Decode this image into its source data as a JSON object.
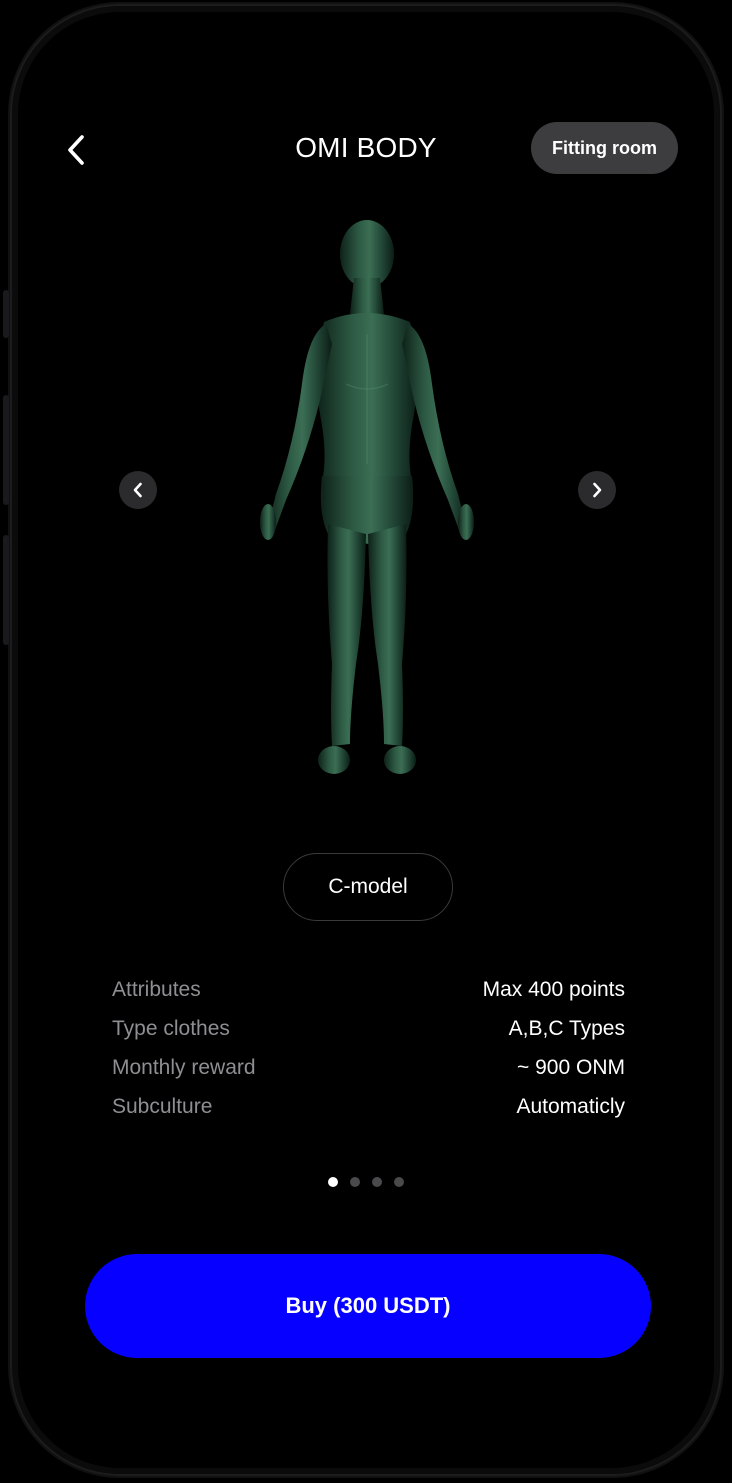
{
  "header": {
    "title": "OMI BODY",
    "fitting_room_label": "Fitting room"
  },
  "carousel": {
    "model_label": "C-model",
    "page_count": 4,
    "active_page": 1
  },
  "specs": [
    {
      "label": "Attributes",
      "value": "Max 400 points"
    },
    {
      "label": "Type clothes",
      "value": "A,B,C Types"
    },
    {
      "label": "Monthly reward",
      "value": "~ 900 ONM"
    },
    {
      "label": "Subculture",
      "value": "Automaticly"
    }
  ],
  "buy_button": {
    "label": "Buy (300 USDT)"
  },
  "colors": {
    "accent": "#0500ff",
    "background": "#000000",
    "model": "#1f3f30"
  },
  "icons": {
    "back": "chevron-left-icon",
    "prev": "chevron-left-icon",
    "next": "chevron-right-icon"
  }
}
